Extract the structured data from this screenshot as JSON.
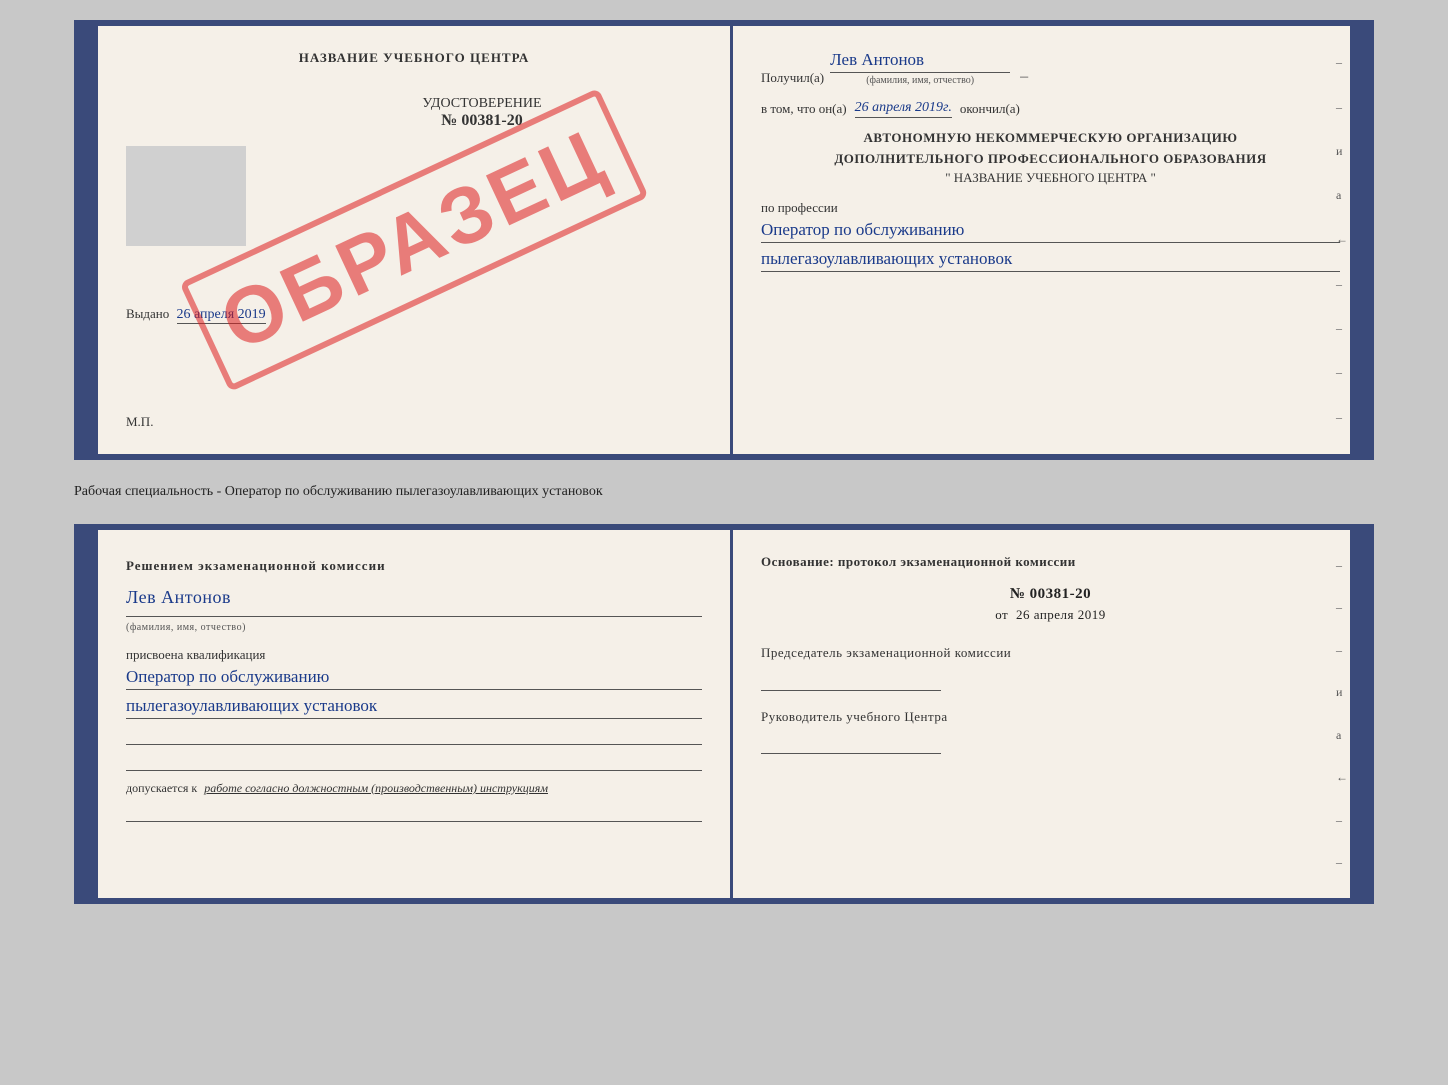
{
  "top_book": {
    "left_page": {
      "title": "НАЗВАНИЕ УЧЕБНОГО ЦЕНТРА",
      "stamp": "ОБРАЗЕЦ",
      "cert_label": "УДОСТОВЕРЕНИЕ",
      "cert_number": "№ 00381-20",
      "issued_label": "Выдано",
      "issued_date": "26 апреля 2019",
      "mp_label": "М.П."
    },
    "right_page": {
      "received_label": "Получил(а)",
      "recipient_name": "Лев Антонов",
      "fio_sub": "(фамилия, имя, отчество)",
      "in_that_label": "в том, что он(а)",
      "date_value": "26 апреля 2019г.",
      "finished_label": "окончил(а)",
      "org_line1": "АВТОНОМНУЮ НЕКОММЕРЧЕСКУЮ ОРГАНИЗАЦИЮ",
      "org_line2": "ДОПОЛНИТЕЛЬНОГО ПРОФЕССИОНАЛЬНОГО ОБРАЗОВАНИЯ",
      "org_name": "\" НАЗВАНИЕ УЧЕБНОГО ЦЕНТРА \"",
      "profession_label": "по профессии",
      "profession_line1": "Оператор по обслуживанию",
      "profession_line2": "пылегазоулавливающих установок"
    }
  },
  "middle_label": "Рабочая специальность - Оператор по обслуживанию пылегазоулавливающих установок",
  "bottom_book": {
    "left_page": {
      "decision_text": "Решением экзаменационной комиссии",
      "person_name": "Лев Антонов",
      "fio_sub": "(фамилия, имя, отчество)",
      "qualification_label": "присвоена квалификация",
      "qualification_line1": "Оператор по обслуживанию",
      "qualification_line2": "пылегазоулавливающих установок",
      "допуск_label": "допускается к",
      "допуск_text": "работе согласно должностным (производственным) инструкциям"
    },
    "right_page": {
      "basis_label": "Основание: протокол экзаменационной комиссии",
      "protocol_number": "№ 00381-20",
      "date_prefix": "от",
      "protocol_date": "26 апреля 2019",
      "chairman_label": "Председатель экзаменационной комиссии",
      "head_label": "Руководитель учебного Центра"
    }
  }
}
